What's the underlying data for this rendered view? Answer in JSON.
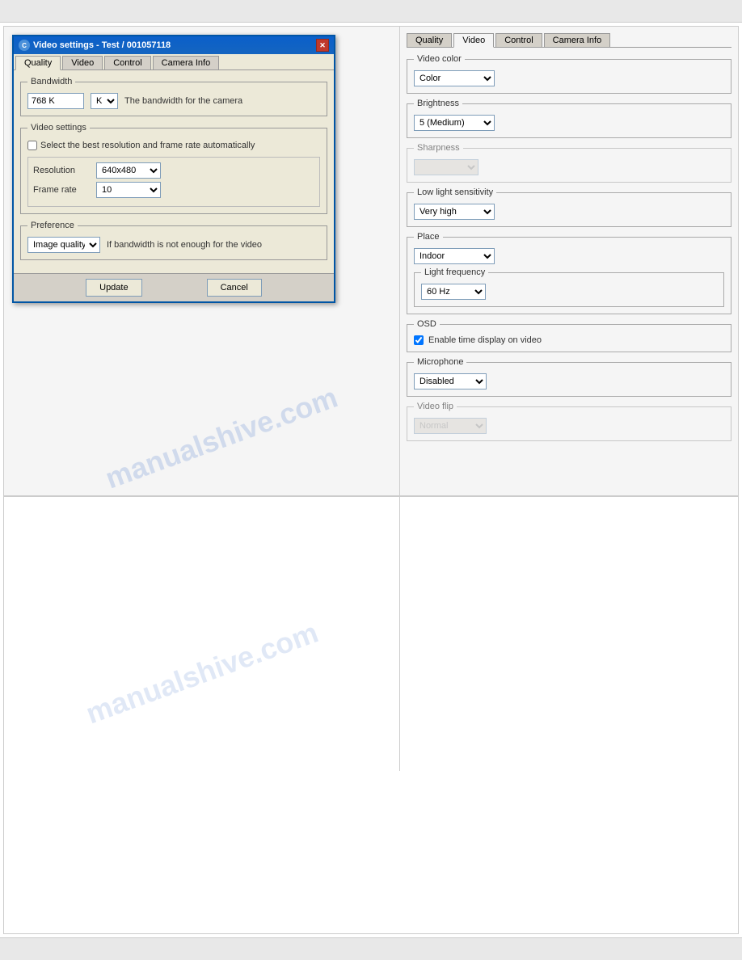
{
  "page": {
    "title": "Video settings – Test / 001057118"
  },
  "dialog": {
    "title": "Video settings - Test / 001057118",
    "tabs": [
      {
        "label": "Quality",
        "active": true
      },
      {
        "label": "Video",
        "active": false
      },
      {
        "label": "Control",
        "active": false
      },
      {
        "label": "Camera Info",
        "active": false
      }
    ],
    "bandwidth": {
      "legend": "Bandwidth",
      "value": "768 K",
      "description": "The bandwidth for the camera"
    },
    "video_settings": {
      "legend": "Video settings",
      "auto_checkbox_label": "Select the best resolution and frame rate automatically",
      "resolution_label": "Resolution",
      "resolution_value": "640x480",
      "frame_rate_label": "Frame rate",
      "frame_rate_value": "10"
    },
    "preference": {
      "legend": "Preference",
      "value": "Image quality",
      "description": "If bandwidth is not enough for the video"
    },
    "buttons": {
      "update": "Update",
      "cancel": "Cancel"
    }
  },
  "right_panel": {
    "tabs": [
      {
        "label": "Quality",
        "active": false
      },
      {
        "label": "Video",
        "active": true
      },
      {
        "label": "Control",
        "active": false
      },
      {
        "label": "Camera Info",
        "active": false
      }
    ],
    "video_color": {
      "legend": "Video color",
      "value": "Color"
    },
    "brightness": {
      "legend": "Brightness",
      "value": "5 (Medium"
    },
    "sharpness": {
      "legend": "Sharpness",
      "value": "",
      "disabled": true
    },
    "low_light": {
      "legend": "Low light sensitivity",
      "value": "Very high"
    },
    "place": {
      "legend": "Place",
      "value": "Indoor",
      "light_frequency": {
        "legend": "Light frequency",
        "value": "60 Hz"
      }
    },
    "osd": {
      "legend": "OSD",
      "checkbox_label": "Enable time display on video",
      "checked": true
    },
    "microphone": {
      "legend": "Microphone",
      "value": "Disabled"
    },
    "video_flip": {
      "legend": "Video flip",
      "value": "Normal",
      "disabled": false
    }
  },
  "watermark": "manualshive.com"
}
